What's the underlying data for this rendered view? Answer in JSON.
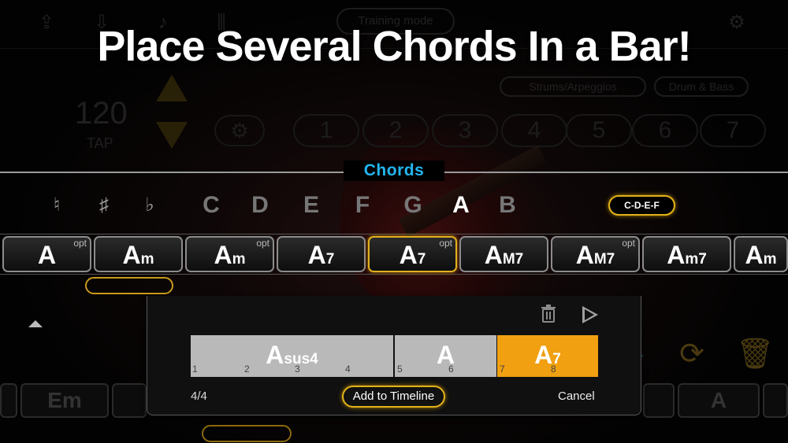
{
  "headline": "Place Several Chords In a Bar!",
  "background_ui": {
    "training_mode": "Training mode",
    "strums_arpeggios": "Strums/Arpeggios",
    "drum_bass": "Drum & Bass",
    "tempo": "120",
    "tap": "TAP",
    "numbers": [
      "1",
      "2",
      "3",
      "4",
      "5",
      "6",
      "7"
    ],
    "bottom_chords": [
      "Em",
      "A"
    ]
  },
  "chords_panel": {
    "title": "Chords",
    "accidentals": [
      "♮",
      "♯",
      "♭"
    ],
    "notes": [
      "C",
      "D",
      "E",
      "F",
      "G",
      "A",
      "B"
    ],
    "selected_note": "A",
    "scale_button": "C-D-E-F",
    "chord_tiles": [
      {
        "root": "A",
        "quality": "",
        "opt": "opt"
      },
      {
        "root": "A",
        "quality": "m",
        "opt": ""
      },
      {
        "root": "A",
        "quality": "m",
        "opt": "opt"
      },
      {
        "root": "A",
        "quality": "7",
        "opt": ""
      },
      {
        "root": "A",
        "quality": "7",
        "opt": "opt"
      },
      {
        "root": "A",
        "quality": "M7",
        "opt": ""
      },
      {
        "root": "A",
        "quality": "M7",
        "opt": "opt"
      },
      {
        "root": "A",
        "quality": "m7",
        "opt": ""
      },
      {
        "root": "A",
        "quality": "m",
        "opt": ""
      }
    ],
    "selected_tile_index": 4
  },
  "bar_editor": {
    "segments": [
      {
        "root": "A",
        "quality": "sus4",
        "beats": [
          "1",
          "2",
          "3",
          "4"
        ],
        "color": "#b9b9b9"
      },
      {
        "root": "A",
        "quality": "",
        "beats": [
          "5",
          "6"
        ],
        "color": "#b9b9b9"
      },
      {
        "root": "A",
        "quality": "7",
        "beats": [
          "7",
          "8"
        ],
        "color": "#f0a010"
      }
    ],
    "time_signature": "4/4",
    "add_button": "Add to Timeline",
    "cancel_button": "Cancel"
  },
  "icons": {
    "trash": "trash-icon",
    "play": "play-icon",
    "settings": "gear-icon",
    "export": "export-icon",
    "import": "import-icon"
  },
  "colors": {
    "accent_gold": "#e3b21a",
    "title_cyan": "#22b6f0",
    "selected_segment": "#f0a010"
  }
}
